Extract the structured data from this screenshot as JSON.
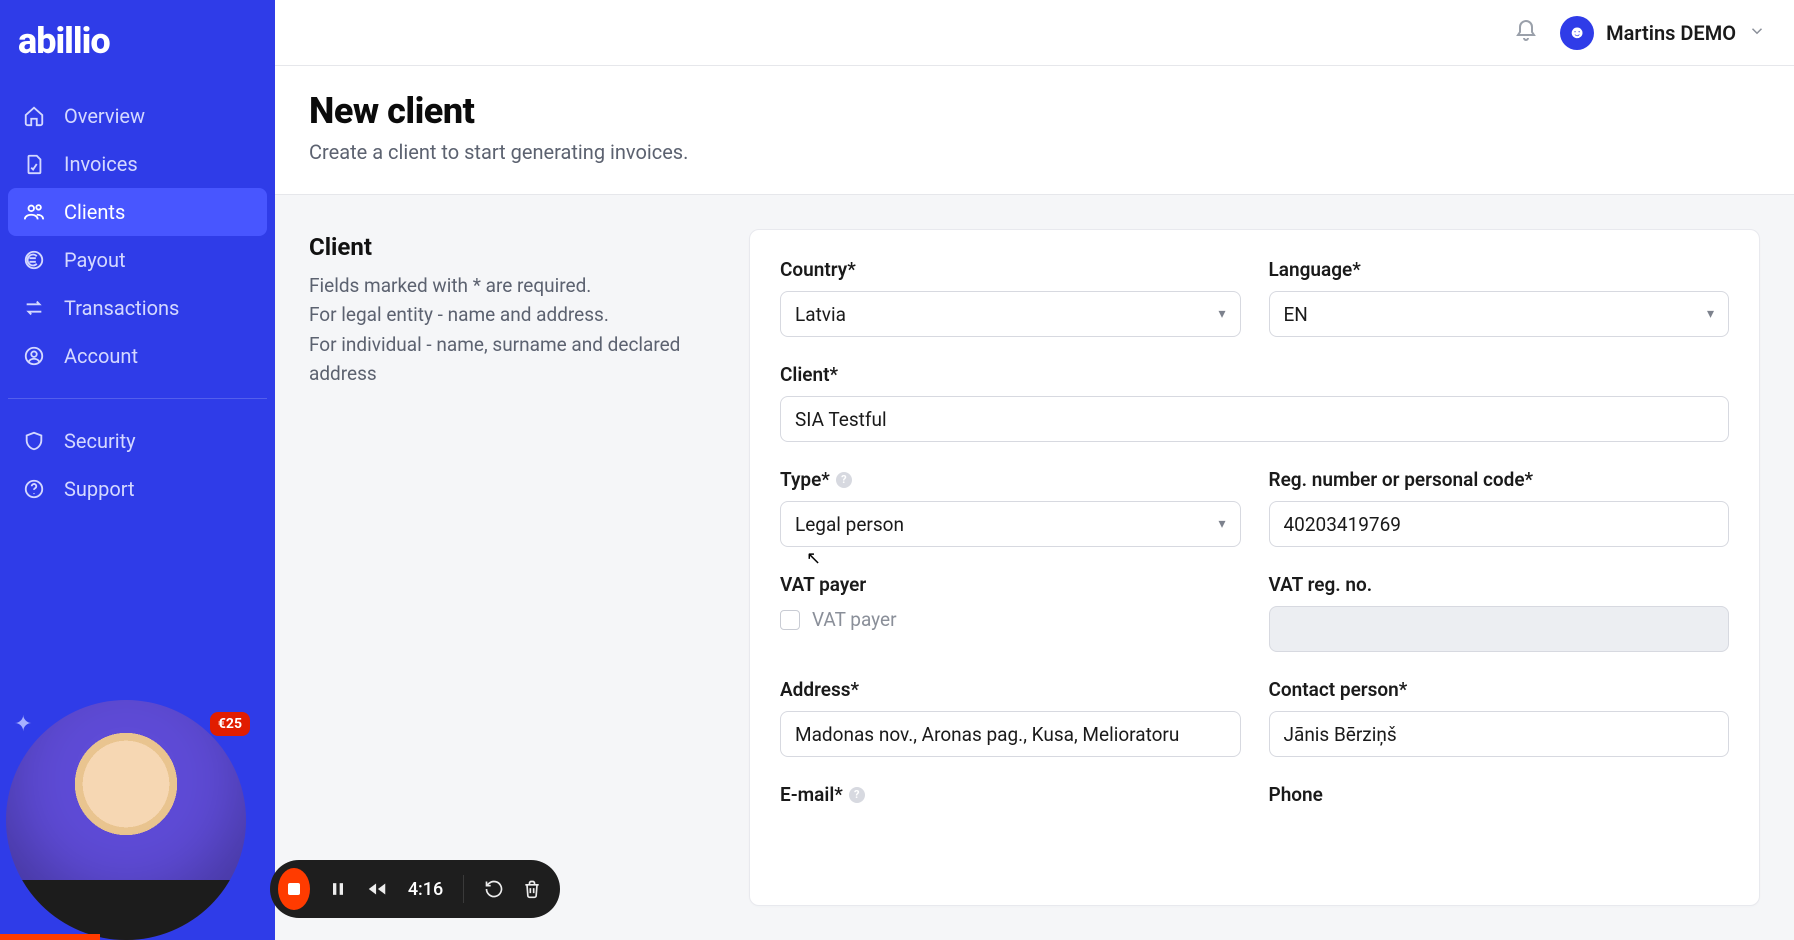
{
  "brand": {
    "logo": "abillio"
  },
  "sidebar": {
    "items": [
      {
        "label": "Overview"
      },
      {
        "label": "Invoices"
      },
      {
        "label": "Clients"
      },
      {
        "label": "Payout"
      },
      {
        "label": "Transactions"
      },
      {
        "label": "Account"
      }
    ],
    "secondary": [
      {
        "label": "Security"
      },
      {
        "label": "Support"
      }
    ],
    "badge": "€25"
  },
  "user": {
    "name": "Martins DEMO"
  },
  "page": {
    "title": "New client",
    "subtitle": "Create a client to start generating invoices."
  },
  "section": {
    "title": "Client",
    "desc_line1": "Fields marked with * are required.",
    "desc_line2": "For legal entity - name and address.",
    "desc_line3": "For individual - name, surname and declared address"
  },
  "form": {
    "country": {
      "label": "Country*",
      "value": "Latvia"
    },
    "language": {
      "label": "Language*",
      "value": "EN"
    },
    "client": {
      "label": "Client*",
      "value": "SIA Testful"
    },
    "type": {
      "label": "Type*",
      "value": "Legal person"
    },
    "regno": {
      "label": "Reg. number or personal code*",
      "value": "40203419769"
    },
    "vat_payer": {
      "label": "VAT payer",
      "checkbox_label": "VAT payer",
      "checked": false
    },
    "vat_regno": {
      "label": "VAT reg. no.",
      "value": ""
    },
    "address": {
      "label": "Address*",
      "value": "Madonas nov., Aronas pag., Kusa, Melioratoru"
    },
    "contact": {
      "label": "Contact person*",
      "value": "Jānis Bērziņš"
    },
    "email": {
      "label": "E-mail*",
      "value": ""
    },
    "phone": {
      "label": "Phone",
      "value": ""
    }
  },
  "recorder": {
    "time": "4:16"
  }
}
